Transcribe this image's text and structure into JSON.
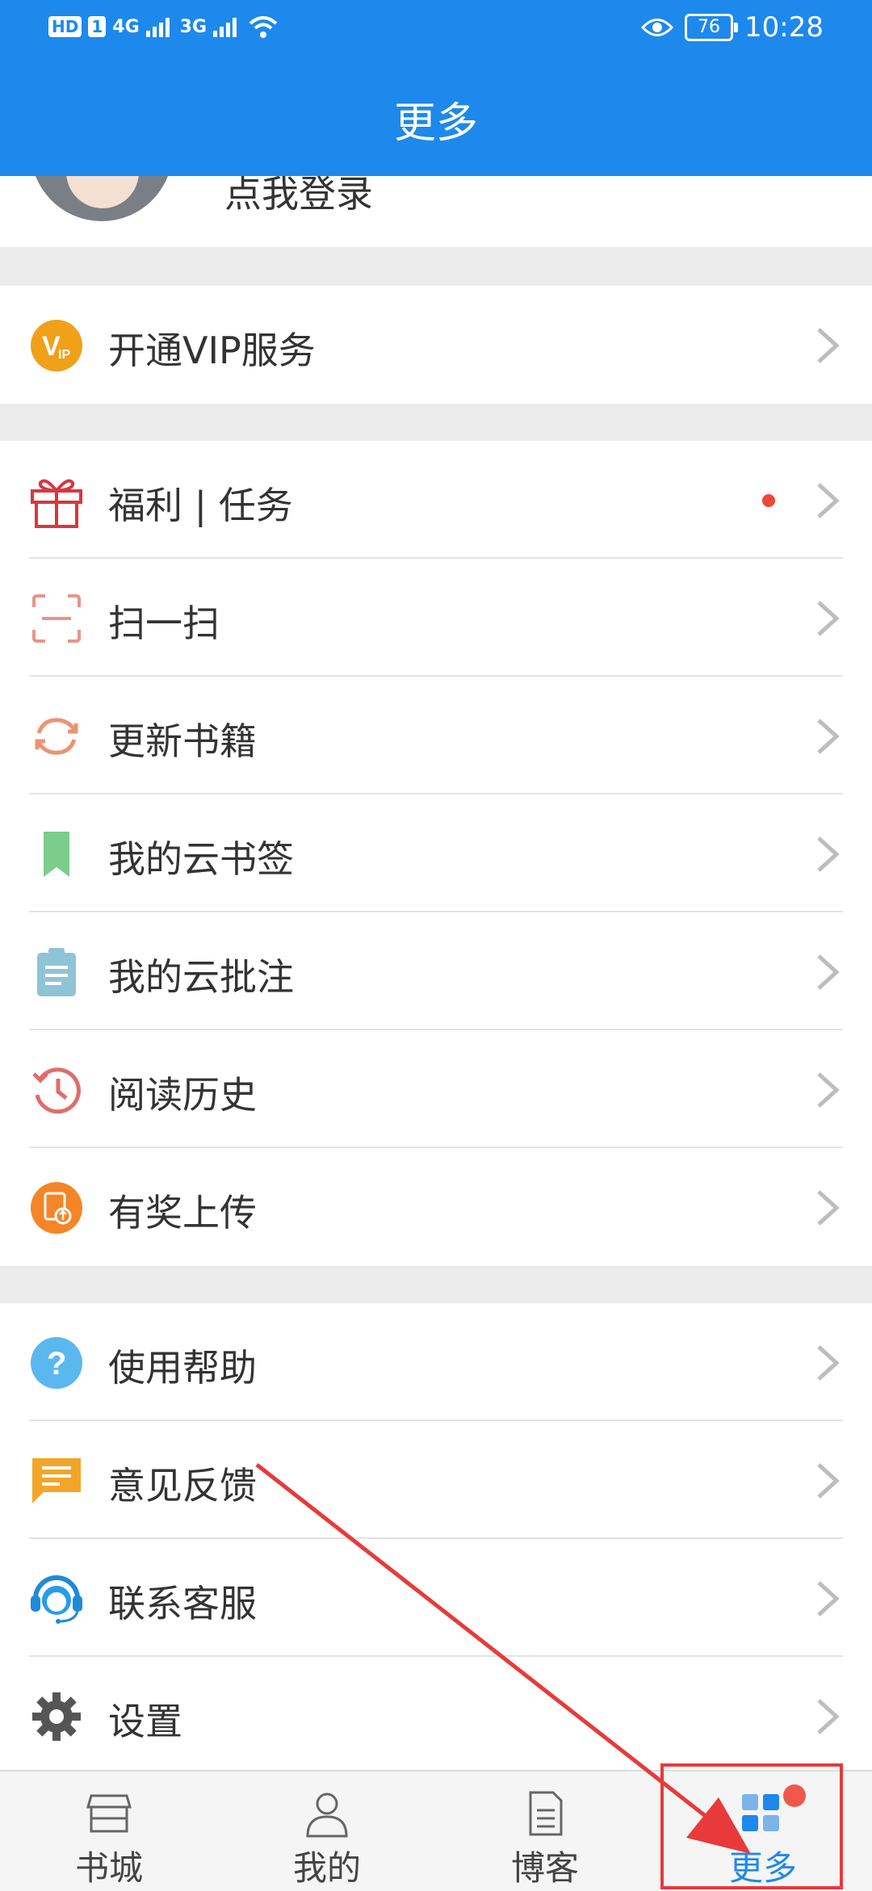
{
  "status_bar": {
    "hd": "HD",
    "sim": "1",
    "net1": "4G",
    "net2": "3G",
    "battery": "76",
    "time": "10:28"
  },
  "header": {
    "title": "更多"
  },
  "profile": {
    "login_text": "点我登录"
  },
  "vip": {
    "label": "开通VIP服务",
    "icon": "vip-icon"
  },
  "menu_main": [
    {
      "label": "福利 | 任务",
      "icon": "gift-icon",
      "dot": true
    },
    {
      "label": "扫一扫",
      "icon": "scan-icon"
    },
    {
      "label": "更新书籍",
      "icon": "refresh-icon"
    },
    {
      "label": "我的云书签",
      "icon": "bookmark-icon"
    },
    {
      "label": "我的云批注",
      "icon": "clipboard-icon"
    },
    {
      "label": "阅读历史",
      "icon": "history-icon"
    },
    {
      "label": "有奖上传",
      "icon": "upload-icon"
    }
  ],
  "menu_help": [
    {
      "label": "使用帮助",
      "icon": "help-icon"
    },
    {
      "label": "意见反馈",
      "icon": "feedback-icon"
    },
    {
      "label": "联系客服",
      "icon": "customer-service-icon"
    },
    {
      "label": "设置",
      "icon": "gear-icon"
    }
  ],
  "tabs": [
    {
      "label": "书城",
      "icon": "store-icon"
    },
    {
      "label": "我的",
      "icon": "person-icon"
    },
    {
      "label": "博客",
      "icon": "document-icon"
    },
    {
      "label": "更多",
      "icon": "more-icon",
      "active": true
    }
  ],
  "colors": {
    "brand": "#1d89ec",
    "annotation": "#e83a3a",
    "dot": "#ef4635"
  }
}
